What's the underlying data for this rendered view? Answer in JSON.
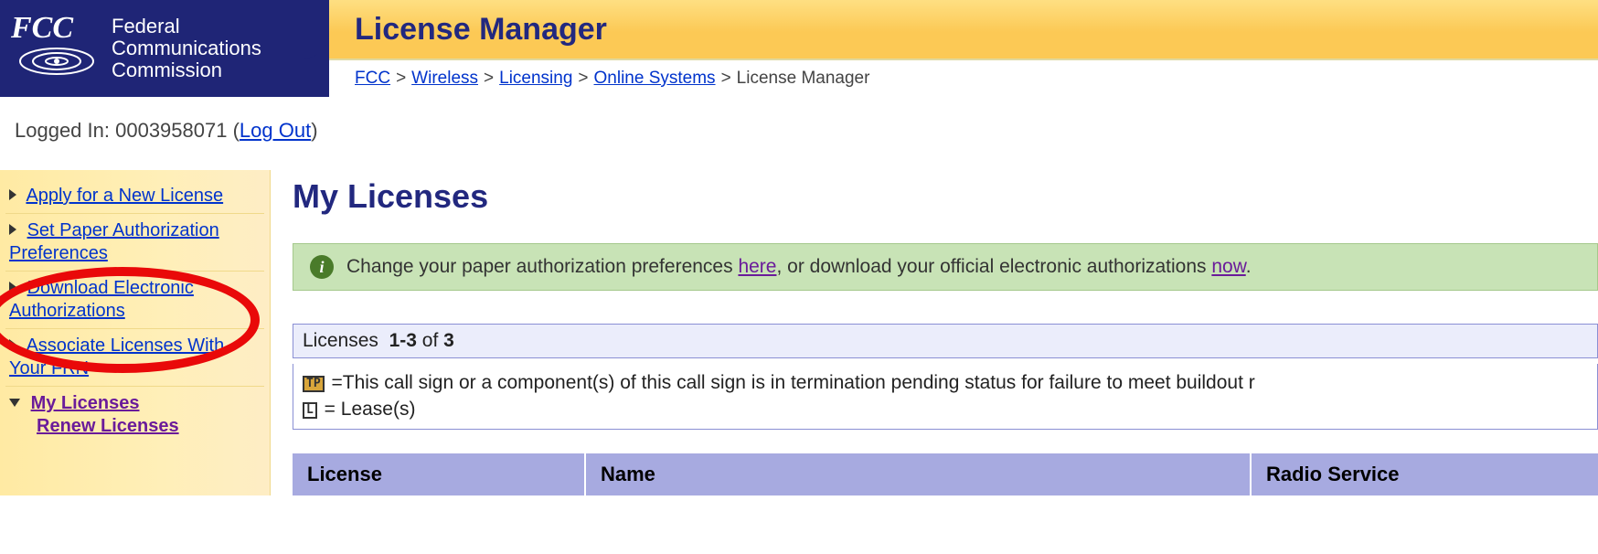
{
  "org": {
    "name_line1": "Federal",
    "name_line2": "Communications",
    "name_line3": "Commission",
    "acronym": "FCC"
  },
  "app_title": "License Manager",
  "breadcrumbs": {
    "items": [
      {
        "label": "FCC",
        "link": true
      },
      {
        "label": "Wireless",
        "link": true
      },
      {
        "label": "Licensing",
        "link": true
      },
      {
        "label": "Online Systems",
        "link": true
      },
      {
        "label": "License Manager",
        "link": false
      }
    ]
  },
  "login": {
    "prefix": "Logged In: ",
    "id": "0003958071",
    "logout_label": "Log Out"
  },
  "sidebar": {
    "items": [
      {
        "label": "Apply for a New License"
      },
      {
        "label": "Set Paper Authorization Preferences"
      },
      {
        "label": "Download Electronic Authorizations"
      },
      {
        "label": "Associate Licenses With Your FRN"
      }
    ],
    "current": {
      "label": "My Licenses"
    },
    "sub": [
      {
        "label": "Renew Licenses"
      }
    ]
  },
  "page_heading": "My Licenses",
  "notice": {
    "text_before": "Change your paper authorization preferences ",
    "link1": "here",
    "text_mid": ", or download your official electronic authorizations ",
    "link2": "now",
    "text_after": "."
  },
  "summary": {
    "label": "Licenses",
    "range": "1-3",
    "of_word": "of",
    "total": "3"
  },
  "legend": {
    "tp": "=This call sign or a component(s) of this call sign is in termination pending status for failure to meet buildout r",
    "l": "= Lease(s)"
  },
  "table": {
    "headers": [
      "License",
      "Name",
      "Radio Service"
    ]
  },
  "colors": {
    "brand_blue": "#1f2576",
    "gold": "#fcc955",
    "link": "#0033cc",
    "visited": "#6a1b9a",
    "notice_bg": "#c8e3b6",
    "table_header": "#a7aae0"
  }
}
